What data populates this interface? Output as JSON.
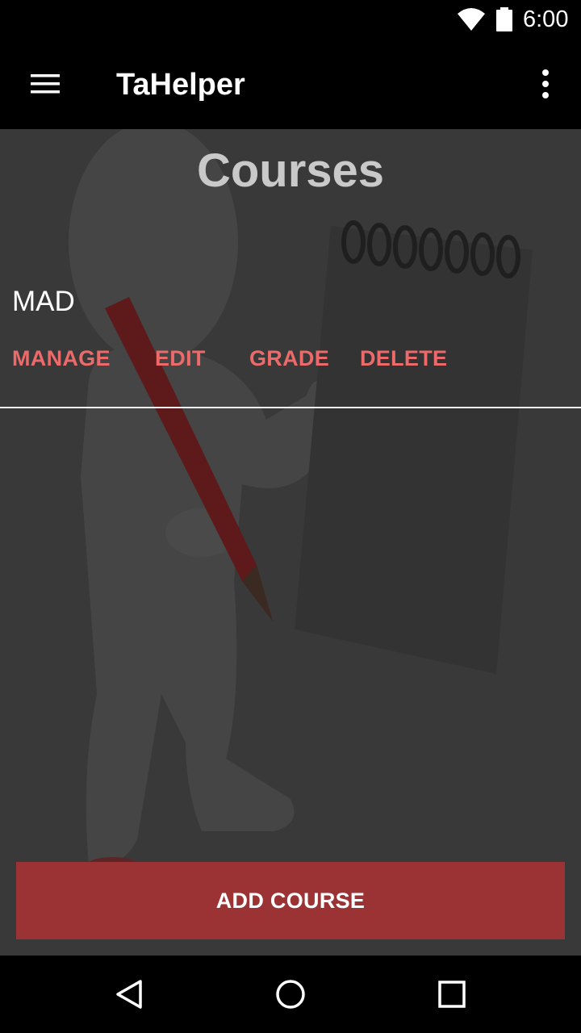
{
  "status_bar": {
    "time": "6:00",
    "icons": [
      "wifi-icon",
      "battery-icon"
    ]
  },
  "toolbar": {
    "title": "TaHelper",
    "menu_icon": "hamburger-menu-icon",
    "overflow_icon": "more-vert-icon"
  },
  "main": {
    "heading": "Courses",
    "courses": [
      {
        "name": "MAD",
        "actions": {
          "manage": "MANAGE",
          "edit": "EDIT",
          "grade": "GRADE",
          "delete": "DELETE"
        }
      }
    ],
    "add_button": "ADD COURSE"
  },
  "nav_bar": {
    "icons": [
      "back-icon",
      "home-icon",
      "recents-icon"
    ]
  },
  "colors": {
    "action_text": "#ec6a6a",
    "add_button_bg": "#9b3334",
    "content_bg": "#393939",
    "heading_text": "#c9c9c9"
  }
}
